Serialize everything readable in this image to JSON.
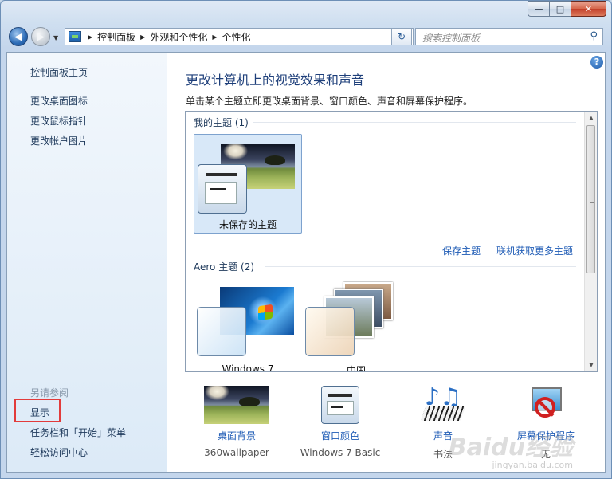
{
  "window": {
    "minimize": "—",
    "maximize": "□",
    "close": "✕"
  },
  "nav": {
    "back_icon": "back-arrow-icon",
    "forward_icon": "forward-arrow-icon",
    "breadcrumb": [
      "控制面板",
      "外观和个性化",
      "个性化"
    ],
    "refresh_glyph": "↻",
    "search_placeholder": "搜索控制面板",
    "search_glyph": "⚲"
  },
  "sidebar": {
    "home": "控制面板主页",
    "links": [
      "更改桌面图标",
      "更改鼠标指针",
      "更改帐户图片"
    ],
    "see_also_heading": "另请参阅",
    "see_also": [
      "显示",
      "任务栏和「开始」菜单",
      "轻松访问中心"
    ]
  },
  "main": {
    "help": "?",
    "title": "更改计算机上的视觉效果和声音",
    "description": "单击某个主题立即更改桌面背景、窗口颜色、声音和屏幕保护程序。",
    "my_themes_label": "我的主题 (1)",
    "unsaved_theme": "未保存的主题",
    "save_theme": "保存主题",
    "get_more": "联机获取更多主题",
    "aero_label": "Aero 主题 (2)",
    "aero_themes": [
      "Windows 7",
      "中国"
    ]
  },
  "bottom": {
    "background": {
      "label": "桌面背景",
      "value": "360wallpaper"
    },
    "color": {
      "label": "窗口颜色",
      "value": "Windows 7 Basic"
    },
    "sound": {
      "label": "声音",
      "value": "书法"
    },
    "saver": {
      "label": "屏幕保护程序",
      "value": "无"
    }
  },
  "watermark": {
    "main": "Baidu经验",
    "sub": "jingyan.baidu.com"
  },
  "colors": {
    "accent_red": "#e23b3b",
    "link_blue": "#1e5bb5",
    "title_blue": "#1e3f7a"
  }
}
